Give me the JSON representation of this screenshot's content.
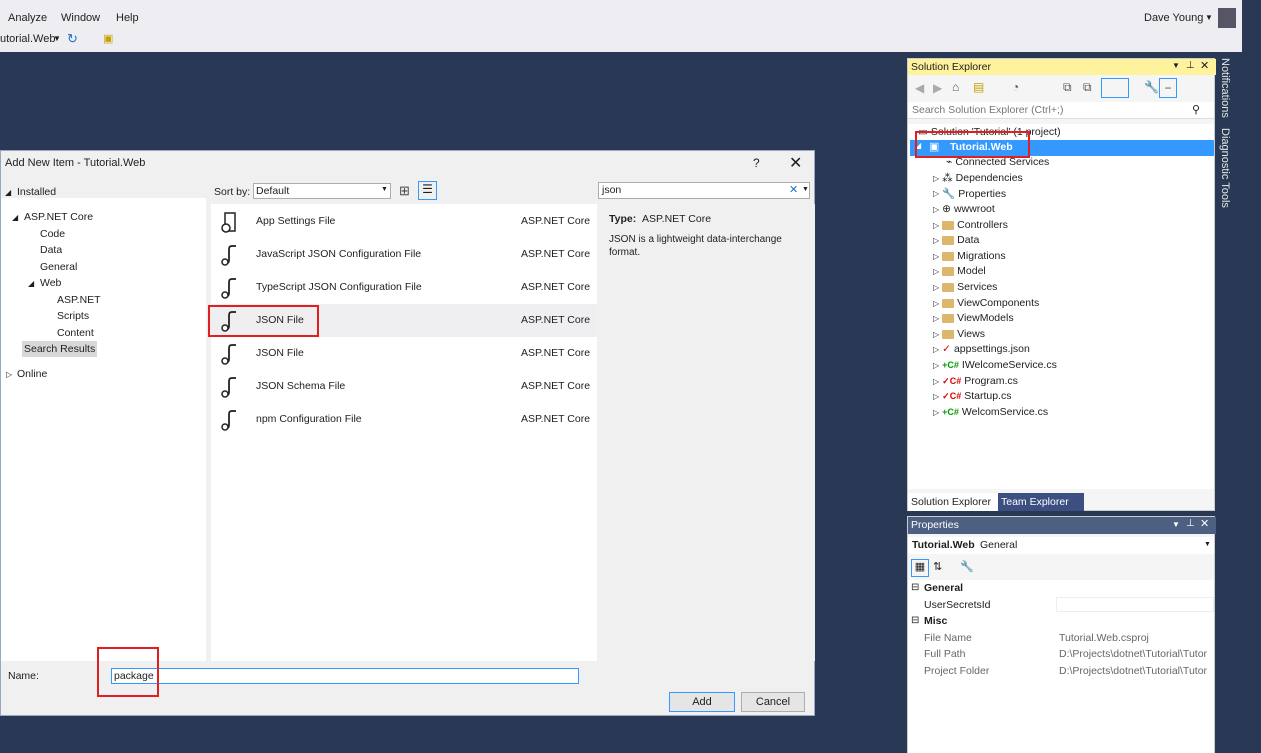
{
  "menu": {
    "items": [
      "Analyze",
      "Window",
      "Help"
    ],
    "user": "Dave Young",
    "project_dropdown": "utorial.Web"
  },
  "side_tabs": [
    "Notifications",
    "Diagnostic Tools"
  ],
  "dialog": {
    "title": "Add New Item - Tutorial.Web",
    "help": "?",
    "sort_label": "Sort by:",
    "sort_value": "Default",
    "search_value": "json",
    "tree": {
      "installed": "Installed",
      "aspnet_core": "ASP.NET Core",
      "code": "Code",
      "data": "Data",
      "general": "General",
      "web": "Web",
      "aspnet": "ASP.NET",
      "scripts": "Scripts",
      "content": "Content",
      "search_results": "Search Results",
      "online": "Online"
    },
    "templates": [
      {
        "name": "App Settings File",
        "category": "ASP.NET Core"
      },
      {
        "name": "JavaScript JSON Configuration File",
        "category": "ASP.NET Core"
      },
      {
        "name": "TypeScript JSON Configuration File",
        "category": "ASP.NET Core"
      },
      {
        "name": "JSON File",
        "category": "ASP.NET Core"
      },
      {
        "name": "JSON File",
        "category": "ASP.NET Core"
      },
      {
        "name": "JSON Schema File",
        "category": "ASP.NET Core"
      },
      {
        "name": "npm Configuration File",
        "category": "ASP.NET Core"
      }
    ],
    "details": {
      "type_label": "Type:",
      "type_value": "ASP.NET Core",
      "description": "JSON is a lightweight data-interchange format."
    },
    "name_label": "Name:",
    "name_value": "package",
    "add": "Add",
    "cancel": "Cancel"
  },
  "solution_explorer": {
    "title": "Solution Explorer",
    "search_placeholder": "Search Solution Explorer (Ctrl+;)",
    "solution": "Solution 'Tutorial' (1 project)",
    "project": "Tutorial.Web",
    "items": [
      "Connected Services",
      "Dependencies",
      "Properties",
      "wwwroot",
      "Controllers",
      "Data",
      "Migrations",
      "Model",
      "Services",
      "ViewComponents",
      "ViewModels",
      "Views",
      "appsettings.json",
      "IWelcomeService.cs",
      "Program.cs",
      "Startup.cs",
      "WelcomService.cs"
    ],
    "tabs": [
      "Solution Explorer",
      "Team Explorer"
    ]
  },
  "properties": {
    "title": "Properties",
    "object": "Tutorial.Web",
    "object_type": "General",
    "sections": {
      "general": "General",
      "user_secrets_label": "UserSecretsId",
      "misc": "Misc",
      "file_name_label": "File Name",
      "file_name_value": "Tutorial.Web.csproj",
      "full_path_label": "Full Path",
      "full_path_value": "D:\\Projects\\dotnet\\Tutorial\\Tutor",
      "folder_label": "Project Folder",
      "folder_value": "D:\\Projects\\dotnet\\Tutorial\\Tutor"
    }
  }
}
